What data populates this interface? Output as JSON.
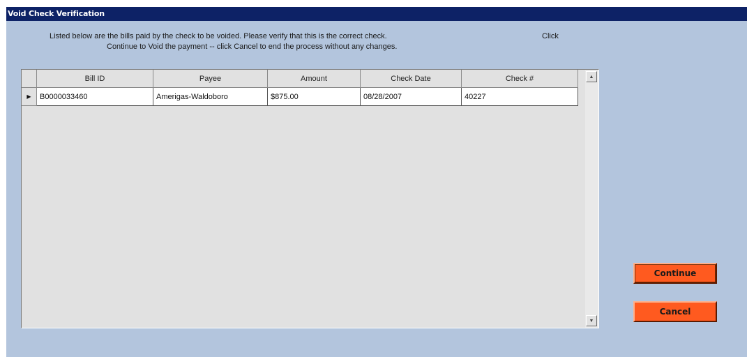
{
  "window": {
    "title": "Void Check Verification"
  },
  "instructions": {
    "line1": "Listed below are the bills paid by the check to be voided.  Please verify that this is the correct check.",
    "click": "Click",
    "line2": "Continue to Void the payment -- click Cancel to end the process without any changes."
  },
  "grid": {
    "columns": [
      "Bill ID",
      "Payee",
      "Amount",
      "Check Date",
      "Check #"
    ],
    "rows": [
      {
        "selector": "current-record-arrow",
        "bill_id": "B0000033460",
        "payee": "Amerigas-Waldoboro",
        "amount": "$875.00",
        "check_date": "08/28/2007",
        "check_number": "40227"
      }
    ]
  },
  "buttons": {
    "continue": "Continue",
    "cancel": "Cancel"
  },
  "colors": {
    "titlebar": "#0d2266",
    "window_bg": "#b3c5dd",
    "grid_bg": "#e1e1e1",
    "button": "#ff5a1f"
  }
}
